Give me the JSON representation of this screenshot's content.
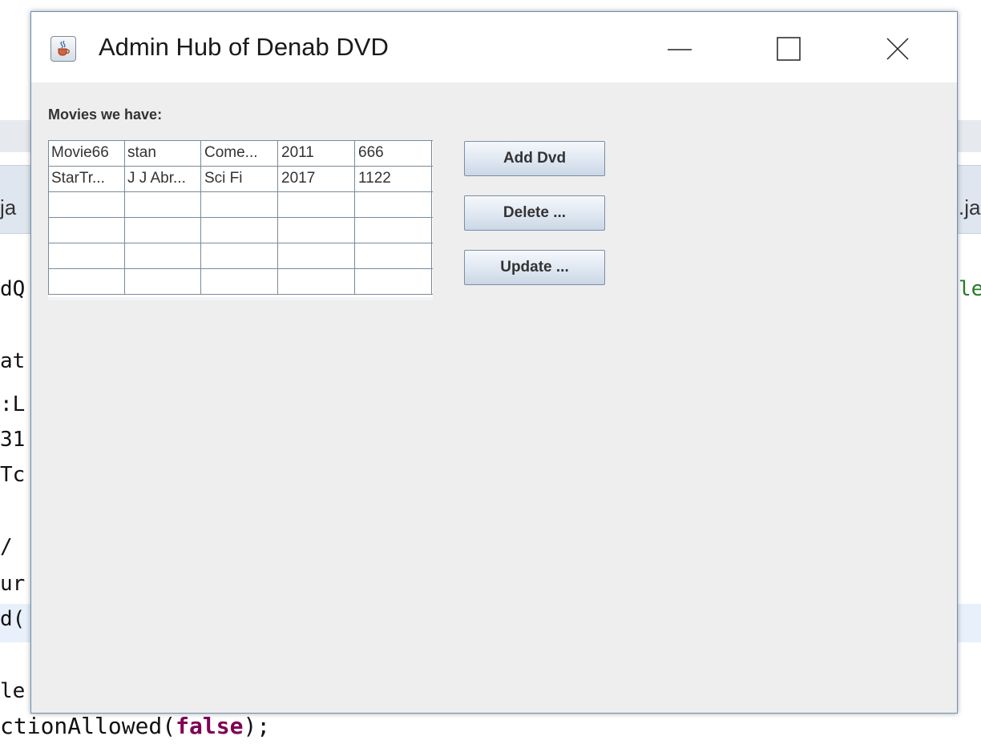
{
  "window": {
    "title": "Admin Hub of Denab DVD",
    "controls": {
      "minimize": "minimize-icon",
      "maximize": "maximize-icon",
      "close": "close-icon"
    }
  },
  "main": {
    "heading": "Movies we have:",
    "table": {
      "rows": [
        [
          "Movie66",
          "stan",
          "Come...",
          "2011",
          "666"
        ],
        [
          "StarTr...",
          "J J Abr...",
          "Sci Fi",
          "2017",
          "1122"
        ],
        [
          "",
          "",
          "",
          "",
          ""
        ],
        [
          "",
          "",
          "",
          "",
          ""
        ],
        [
          "",
          "",
          "",
          "",
          ""
        ],
        [
          "",
          "",
          "",
          "",
          ""
        ]
      ]
    },
    "buttons": {
      "add": "Add Dvd",
      "delete": "Delete ...",
      "update": "Update ..."
    }
  },
  "background_ide": {
    "tab_left": "ja",
    "tab_right": ".ja",
    "lines_left": [
      "dQ",
      "at",
      ":L",
      "31",
      "Tc",
      "/",
      "ur",
      "d(",
      "le"
    ],
    "line_right": "le",
    "last_line_prefix": "ctionAllowed(",
    "last_line_keyword": "false",
    "last_line_suffix": ");"
  },
  "colors": {
    "window_bg": "#eeeeee",
    "border": "#6d8fb3",
    "grid": "#7a8a99",
    "keyword": "#7f0055"
  }
}
